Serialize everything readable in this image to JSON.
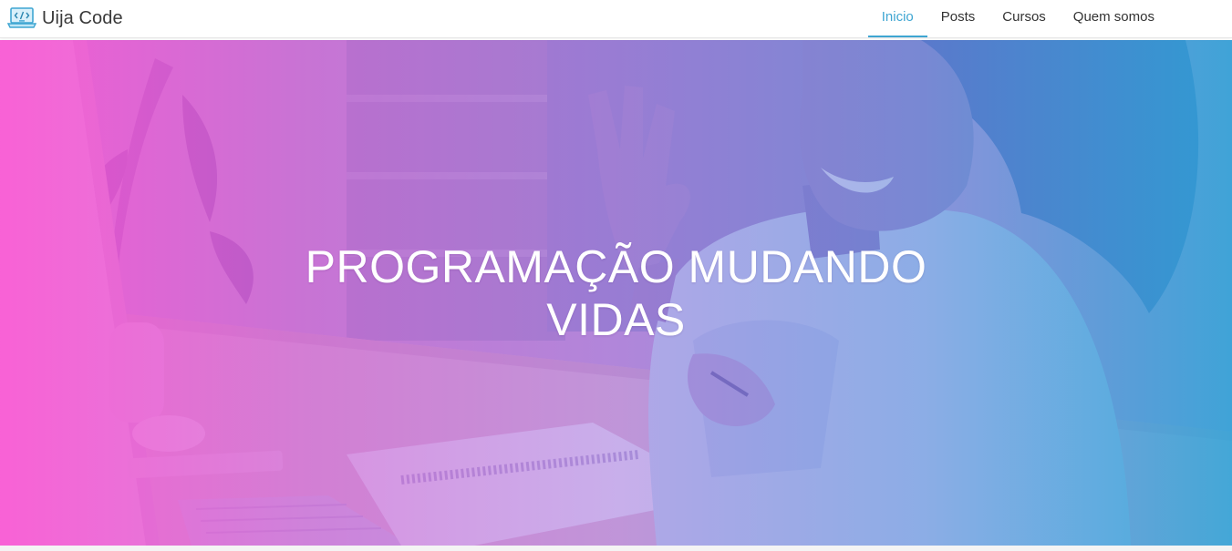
{
  "header": {
    "brand_name": "Uija Code",
    "brand_icon": "laptop-code-icon",
    "nav": [
      {
        "label": "Inicio",
        "active": true
      },
      {
        "label": "Posts",
        "active": false
      },
      {
        "label": "Cursos",
        "active": false
      },
      {
        "label": "Quem somos",
        "active": false
      }
    ]
  },
  "hero": {
    "title_line1": "PROGRAMAÇÃO MUDANDO",
    "title_line2": "VIDAS"
  },
  "colors": {
    "accent": "#3fa6d2",
    "gradient_left": "#f550d2",
    "gradient_right": "#28a5d7"
  }
}
